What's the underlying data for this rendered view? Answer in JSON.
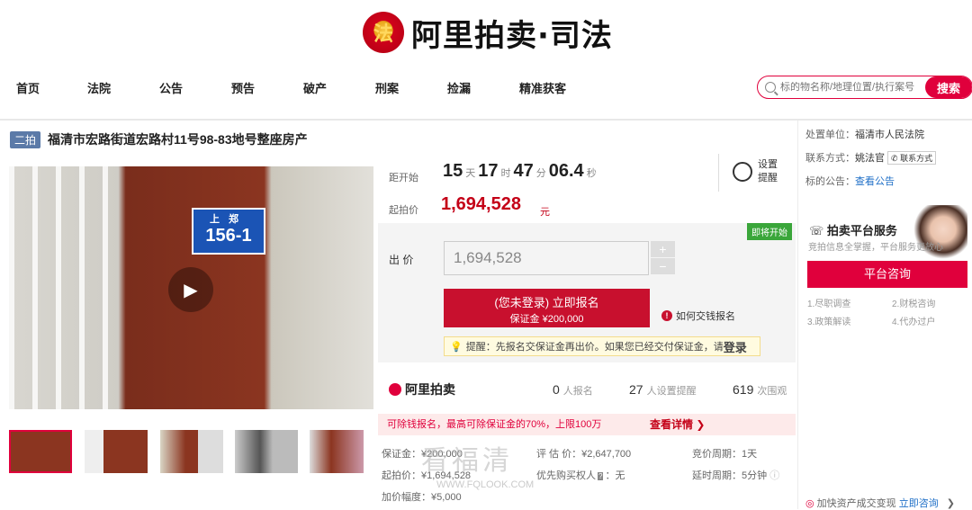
{
  "header": {
    "brand": "阿里拍卖·司法",
    "emblem": "法"
  },
  "nav": {
    "items": [
      "首页",
      "法院",
      "公告",
      "预告",
      "破产",
      "刑案",
      "捡漏",
      "精准获客"
    ]
  },
  "search": {
    "placeholder": "标的物名称/地理位置/执行案号",
    "button": "搜索"
  },
  "item": {
    "tag": "二拍",
    "title": "福清市宏路街道宏路村11号98-83地号整座房产",
    "plate_top": "上郑",
    "plate_num": "156-1"
  },
  "countdown": {
    "label": "距开始",
    "days": "15",
    "days_u": "天",
    "hours": "17",
    "hours_u": "时",
    "mins": "47",
    "mins_u": "分",
    "secs": "06.4",
    "secs_u": "秒",
    "remind": "设置",
    "remind2": "提醒"
  },
  "price": {
    "start_label": "起拍价",
    "start": "1,694,528",
    "unit": "元"
  },
  "bid": {
    "badge": "即将开始",
    "label": "出 价",
    "value": "1,694,528",
    "plus": "+",
    "minus": "−",
    "signup1": "(您未登录) 立即报名",
    "signup2": "保证金 ¥200,000",
    "howto": "如何交钱报名",
    "tip": "提醒：先报名交保证金再出价。如果您已经交付保证金，请",
    "tip_login": "登录"
  },
  "stats": {
    "logo": "阿里拍卖",
    "signups": "0",
    "signups_l": "人报名",
    "reminders": "27",
    "reminders_l": "人设置提醒",
    "views": "619",
    "views_l": "次围观"
  },
  "promo": {
    "text": "可除钱报名，最高可除保证金的70%，上限100万",
    "more": "查看详情 ❯"
  },
  "details": {
    "deposit": "保证金：¥200,000",
    "eval": "评 估 价：¥2,647,700",
    "period": "竞价周期：1天",
    "start": "起拍价：¥1,694,528",
    "priority": "优先购买权人",
    "priority_v": "：无",
    "delay": "延时周期：5分钟",
    "step": "加价幅度：¥5,000"
  },
  "right": {
    "court_l": "处置单位：",
    "court": "福清市人民法院",
    "contact_l": "联系方式：",
    "contact": "姚法官",
    "contact_btn": "联系方式",
    "notice_l": "标的公告：",
    "notice": "查看公告",
    "svc_title": "拍卖平台服务",
    "svc_sub": "竞拍信息全掌握，平台服务更放心",
    "consult": "平台咨询",
    "svc1": "1.尽职调查",
    "svc2": "2.财税咨询",
    "svc3": "3.政策解读",
    "svc4": "4.代办过户",
    "bottom": "加快资产成交变现",
    "bottom_link": "立即咨询",
    "bottom_arrow": "❯"
  },
  "watermark": {
    "big": "看福清",
    "small": "WWW.FQLOOK.COM"
  }
}
